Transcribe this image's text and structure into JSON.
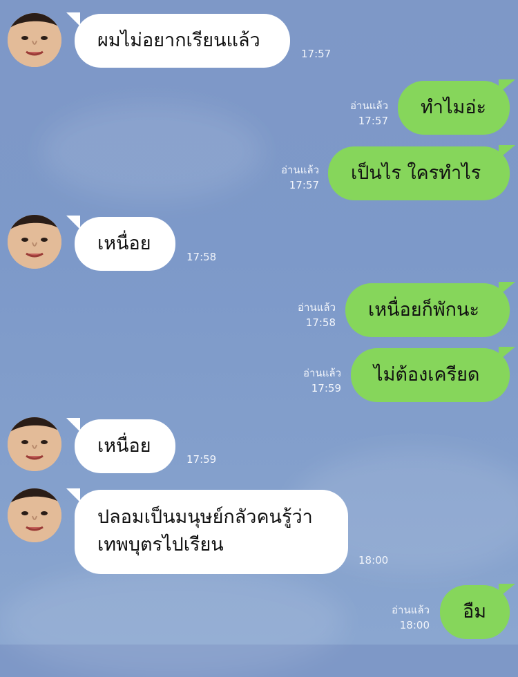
{
  "chat": {
    "messages": [
      {
        "text": "ผมไม่อยากเรียนแล้ว",
        "time": "17:57"
      },
      {
        "text": "ทำไมอ่ะ",
        "read": "อ่านแล้ว",
        "time": "17:57"
      },
      {
        "text": "เป็นไร ใครทำไร",
        "read": "อ่านแล้ว",
        "time": "17:57"
      },
      {
        "text": "เหนื่อย",
        "time": "17:58"
      },
      {
        "text": "เหนื่อยก็พักนะ",
        "read": "อ่านแล้ว",
        "time": "17:58"
      },
      {
        "text": "ไม่ต้องเครียด",
        "read": "อ่านแล้ว",
        "time": "17:59"
      },
      {
        "text": "เหนื่อย",
        "time": "17:59"
      },
      {
        "lines": [
          "ปลอมเป็นมนุษย์กลัวคนรู้ว่า",
          "เทพบุตรไปเรียน"
        ],
        "time": "18:00"
      },
      {
        "text": "อืม",
        "read": "อ่านแล้ว",
        "time": "18:00"
      }
    ]
  },
  "colors": {
    "background": "#7e98c7",
    "incoming_bubble": "#ffffff",
    "outgoing_bubble": "#86d65b"
  }
}
